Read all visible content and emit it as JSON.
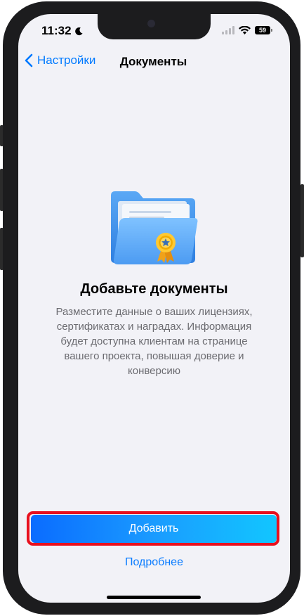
{
  "status_bar": {
    "time": "11:32",
    "battery": "59"
  },
  "nav": {
    "back_label": "Настройки",
    "title": "Документы"
  },
  "empty_state": {
    "title": "Добавьте документы",
    "description": "Разместите данные о ваших лицензиях, сертификатах и наградах. Информация будет доступна клиентам на странице вашего проекта, повышая доверие и конверсию"
  },
  "actions": {
    "add_label": "Добавить",
    "more_label": "Подробнее"
  },
  "colors": {
    "accent": "#007aff",
    "highlight_outline": "#e8101e",
    "screen_background": "#f2f2f7"
  },
  "icons": {
    "back": "chevron-left-icon",
    "moon": "moon-icon",
    "signal": "cellular-signal-icon",
    "wifi": "wifi-icon",
    "battery": "battery-icon",
    "illustration": "award-folder-icon"
  }
}
